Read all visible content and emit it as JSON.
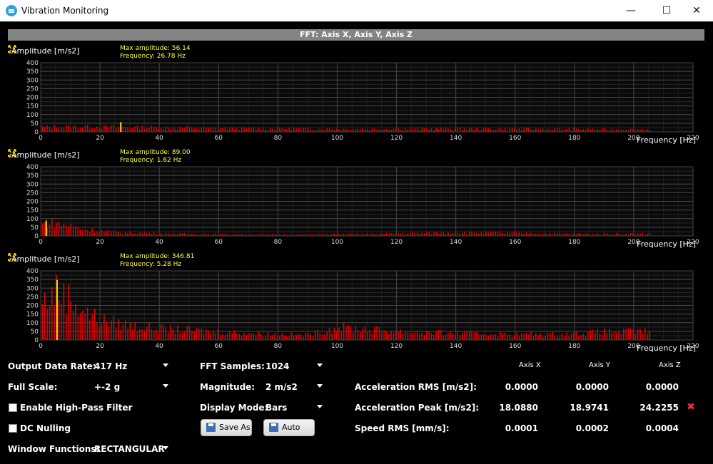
{
  "window": {
    "title": "Vibration Monitoring",
    "minimize_glyph": "—",
    "maximize_glyph": "☐",
    "close_glyph": "✕"
  },
  "panel_header": "FFT: Axis X, Axis Y, Axis Z",
  "charts": [
    {
      "id": "axis-x",
      "ylabel": "Amplitude [m/s2]",
      "xlabel": "Frequency [Hz]",
      "annotation_line1": "Max amplitude: 56.14",
      "annotation_line2": "Frequency: 26.78 Hz",
      "peak_frequency": 26.78,
      "peak_amplitude": 56.14
    },
    {
      "id": "axis-y",
      "ylabel": "Amplitude [m/s2]",
      "xlabel": "Frequency [Hz]",
      "annotation_line1": "Max amplitude: 89.00",
      "annotation_line2": "Frequency:  1.62 Hz",
      "peak_frequency": 1.62,
      "peak_amplitude": 89.0
    },
    {
      "id": "axis-z",
      "ylabel": "Amplitude [m/s2]",
      "xlabel": "Frequency [Hz]",
      "annotation_line1": "Max amplitude: 346.81",
      "annotation_line2": "Frequency:  5.28 Hz",
      "peak_frequency": 5.28,
      "peak_amplitude": 346.81
    }
  ],
  "chart_data": [
    {
      "type": "bar",
      "xlim": [
        0,
        220
      ],
      "ylim": [
        0,
        400
      ],
      "yticks": [
        0,
        50,
        100,
        150,
        200,
        250,
        300,
        350,
        400
      ],
      "xticks": [
        0,
        20,
        40,
        60,
        80,
        100,
        120,
        140,
        160,
        180,
        200,
        220
      ],
      "grid": true,
      "bar_color": "#e00000",
      "peak_color": "#ffe000",
      "x_max_data": 206,
      "profile": [
        [
          0,
          28
        ],
        [
          10,
          32
        ],
        [
          26,
          30
        ],
        [
          60,
          22
        ],
        [
          100,
          18
        ],
        [
          140,
          20
        ],
        [
          206,
          15
        ]
      ],
      "peak": {
        "x": 26.78,
        "y": 56.14
      }
    },
    {
      "type": "bar",
      "xlim": [
        0,
        220
      ],
      "ylim": [
        0,
        400
      ],
      "yticks": [
        0,
        50,
        100,
        150,
        200,
        250,
        300,
        350,
        400
      ],
      "xticks": [
        0,
        20,
        40,
        60,
        80,
        100,
        120,
        140,
        160,
        180,
        200,
        220
      ],
      "grid": true,
      "bar_color": "#e00000",
      "peak_color": "#ffe000",
      "x_max_data": 206,
      "profile": [
        [
          0,
          70
        ],
        [
          4,
          80
        ],
        [
          8,
          70
        ],
        [
          15,
          40
        ],
        [
          25,
          22
        ],
        [
          50,
          12
        ],
        [
          80,
          8
        ],
        [
          110,
          12
        ],
        [
          140,
          22
        ],
        [
          160,
          18
        ],
        [
          185,
          12
        ],
        [
          206,
          14
        ]
      ],
      "peak": {
        "x": 1.62,
        "y": 89.0
      }
    },
    {
      "type": "bar",
      "xlim": [
        0,
        220
      ],
      "ylim": [
        0,
        400
      ],
      "yticks": [
        0,
        50,
        100,
        150,
        200,
        250,
        300,
        350,
        400
      ],
      "xticks": [
        0,
        20,
        40,
        60,
        80,
        100,
        120,
        140,
        160,
        180,
        200,
        220
      ],
      "grid": true,
      "bar_color": "#e00000",
      "peak_color": "#ffe000",
      "x_max_data": 206,
      "profile": [
        [
          0,
          220
        ],
        [
          5,
          300
        ],
        [
          10,
          250
        ],
        [
          15,
          170
        ],
        [
          20,
          120
        ],
        [
          30,
          90
        ],
        [
          40,
          70
        ],
        [
          60,
          50
        ],
        [
          80,
          35
        ],
        [
          90,
          30
        ],
        [
          100,
          80
        ],
        [
          115,
          60
        ],
        [
          130,
          45
        ],
        [
          160,
          35
        ],
        [
          175,
          35
        ],
        [
          190,
          50
        ],
        [
          206,
          55
        ]
      ],
      "peak": {
        "x": 5.28,
        "y": 346.81
      }
    }
  ],
  "controls": {
    "output_data_rate": {
      "label": "Output Data Rate:",
      "value": "417 Hz"
    },
    "full_scale": {
      "label": "Full Scale:",
      "value": "+-2 g"
    },
    "high_pass": {
      "label": "Enable High-Pass Filter"
    },
    "dc_nulling": {
      "label": "DC Nulling"
    },
    "window_functions": {
      "label": "Window Functions:",
      "value": "RECTANGULAR"
    },
    "fft_samples": {
      "label": "FFT Samples:",
      "value": "1024"
    },
    "magnitude": {
      "label": "Magnitude:",
      "value": "2 m/s2"
    },
    "display_mode": {
      "label": "Display Mode:",
      "value": "Bars"
    },
    "save_as": "Save As",
    "auto_save": "Auto Save"
  },
  "stats": {
    "columns": [
      "Axis X",
      "Axis Y",
      "Axis Z"
    ],
    "rows": [
      {
        "label": "Acceleration RMS [m/s2]:",
        "values": [
          "0.0000",
          "0.0000",
          "0.0000"
        ]
      },
      {
        "label": "Acceleration Peak [m/s2]:",
        "values": [
          "18.0880",
          "18.9741",
          "24.2255"
        ]
      },
      {
        "label": "Speed RMS [mm/s]:",
        "values": [
          "0.0001",
          "0.0002",
          "0.0004"
        ]
      }
    ],
    "reset_glyph": "✖"
  }
}
